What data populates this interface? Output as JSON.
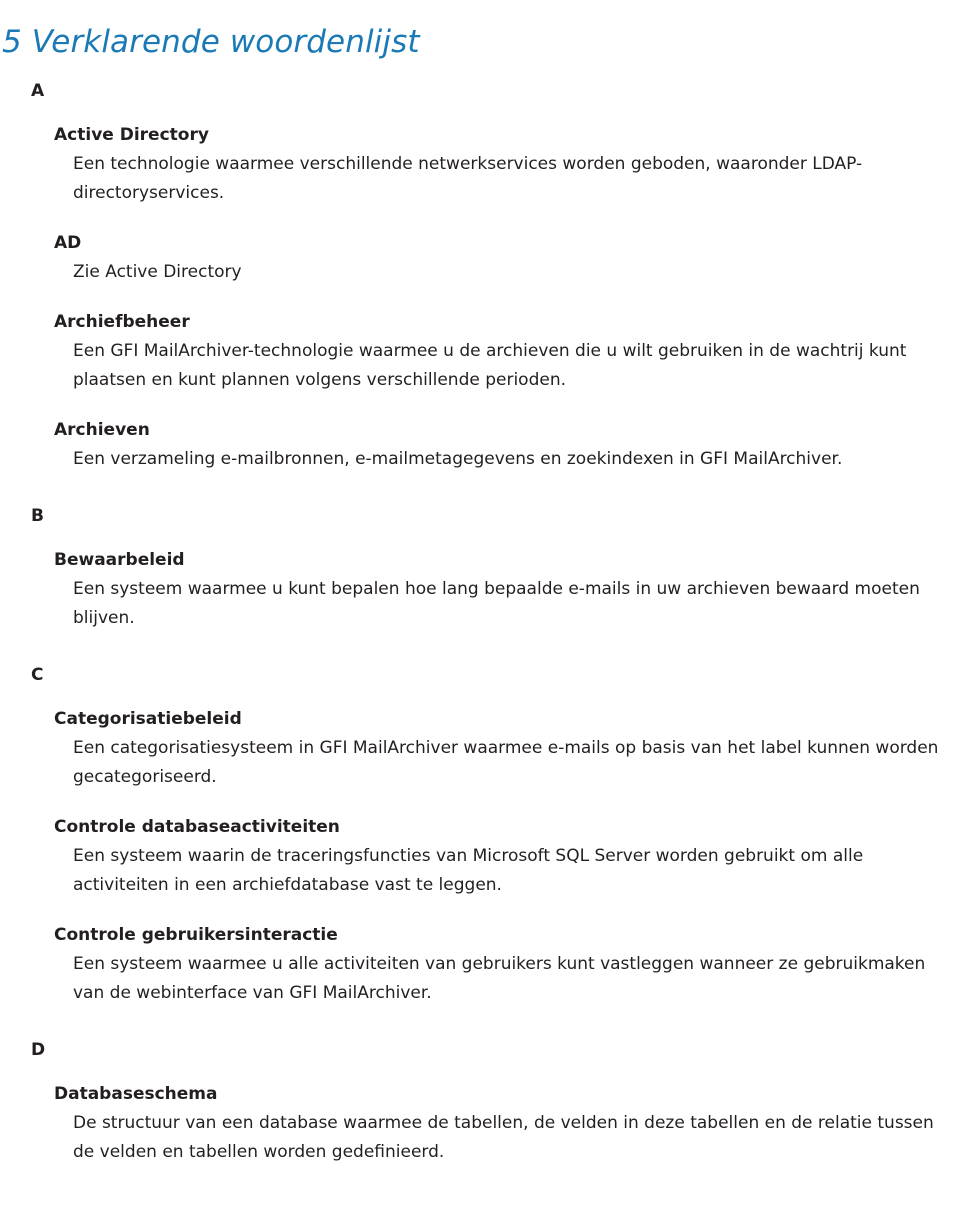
{
  "document": {
    "title": "5 Verklarende woordenlijst",
    "title_color": "#1b7ab5",
    "body_color": "#231f20",
    "background_color": "#ffffff"
  },
  "groups": [
    {
      "letter": "A",
      "entries": [
        {
          "term": "Active Directory",
          "definition": "Een technologie waarmee verschillende netwerkservices worden geboden, waaronder LDAP-directoryservices."
        },
        {
          "term": "AD",
          "definition": "Zie Active Directory"
        },
        {
          "term": "Archiefbeheer",
          "definition": "Een GFI MailArchiver-technologie waarmee u de archieven die u wilt gebruiken in de wachtrij kunt plaatsen en kunt plannen volgens verschillende perioden."
        },
        {
          "term": "Archieven",
          "definition": "Een verzameling e-mailbronnen, e-mailmetagegevens en zoekindexen in GFI MailArchiver."
        }
      ]
    },
    {
      "letter": "B",
      "entries": [
        {
          "term": "Bewaarbeleid",
          "definition": "Een systeem waarmee u kunt bepalen hoe lang bepaalde e-mails in uw archieven bewaard moeten blijven."
        }
      ]
    },
    {
      "letter": "C",
      "entries": [
        {
          "term": "Categorisatiebeleid",
          "definition": "Een categorisatiesysteem in GFI MailArchiver waarmee e-mails op basis van het label kunnen worden gecategoriseerd."
        },
        {
          "term": "Controle databaseactiviteiten",
          "definition": "Een systeem waarin de traceringsfuncties van Microsoft SQL Server worden gebruikt om alle activiteiten in een archiefdatabase vast te leggen."
        },
        {
          "term": "Controle gebruikersinteractie",
          "definition": "Een systeem waarmee u alle activiteiten van gebruikers kunt vastleggen wanneer ze gebruikmaken van de webinterface van GFI MailArchiver."
        }
      ]
    },
    {
      "letter": "D",
      "entries": [
        {
          "term": "Databaseschema",
          "definition": "De structuur van een database waarmee de tabellen, de velden in deze tabellen en de relatie tussen de velden en tabellen worden gedefinieerd."
        }
      ]
    }
  ]
}
